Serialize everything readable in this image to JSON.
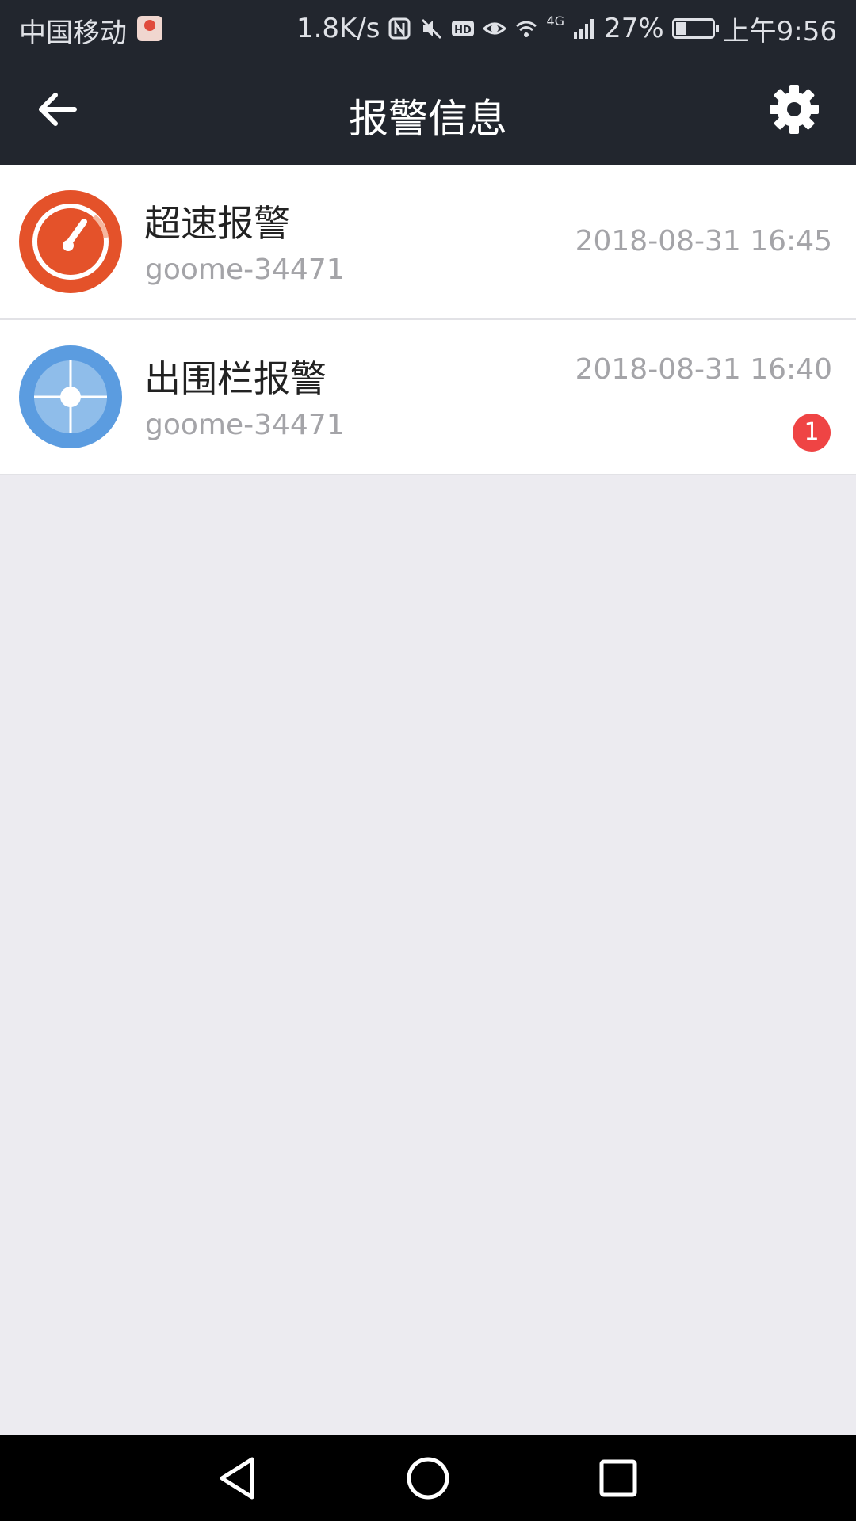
{
  "status_bar": {
    "carrier": "中国移动",
    "net_speed": "1.8K/s",
    "network_type": "4G",
    "battery_percent": "27%",
    "battery_level": 0.27,
    "time": "上午9:56",
    "icons": [
      "nfc-icon",
      "mute-icon",
      "hd-icon",
      "eye-icon",
      "wifi-icon",
      "signal-icon",
      "battery-icon"
    ]
  },
  "app_bar": {
    "title": "报警信息",
    "back_icon": "arrow-left-icon",
    "settings_icon": "gear-icon"
  },
  "alarms": [
    {
      "name": "超速报警",
      "device": "goome-34471",
      "time": "2018-08-31 16:45",
      "icon": "speedometer-icon",
      "icon_color": "#e4522a",
      "unread": ""
    },
    {
      "name": "出围栏报警",
      "device": "goome-34471",
      "time": "2018-08-31 16:40",
      "icon": "crosshair-icon",
      "icon_color": "#5b9ce0",
      "unread": "1"
    }
  ],
  "nav_bar": {
    "back_icon": "triangle-back-icon",
    "home_icon": "circle-home-icon",
    "recent_icon": "square-recent-icon"
  },
  "colors": {
    "header_bg": "#22262e",
    "page_bg": "#ecebf0",
    "badge_red": "#ef4444"
  }
}
